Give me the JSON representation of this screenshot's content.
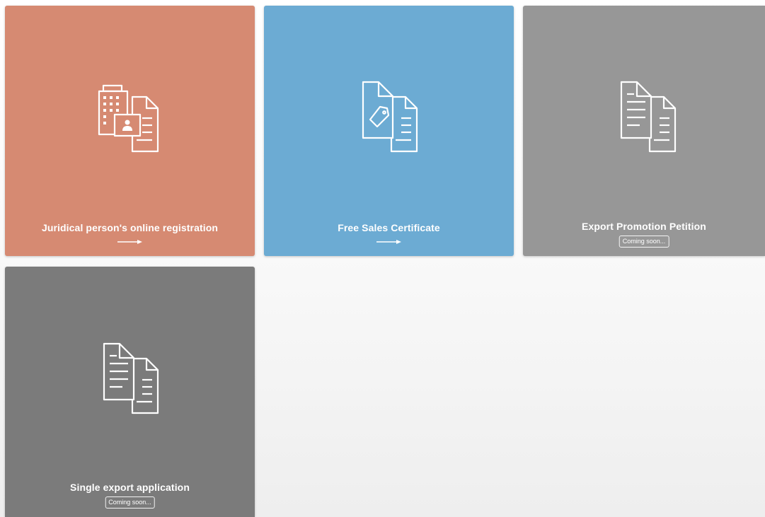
{
  "tiles": [
    {
      "title": "Juridical person's online registration",
      "icon": "building-document-icon",
      "color": "#d68a72",
      "status": "available"
    },
    {
      "title": "Free Sales Certificate",
      "icon": "tag-document-icon",
      "color": "#6cabd3",
      "status": "available"
    },
    {
      "title": "Export Promotion Petition",
      "icon": "documents-icon",
      "color": "#979797",
      "status": "coming_soon",
      "badge": "Coming soon..."
    },
    {
      "title": "Single export application",
      "icon": "documents-icon",
      "color": "#7b7b7b",
      "status": "coming_soon",
      "badge": "Coming soon..."
    }
  ]
}
